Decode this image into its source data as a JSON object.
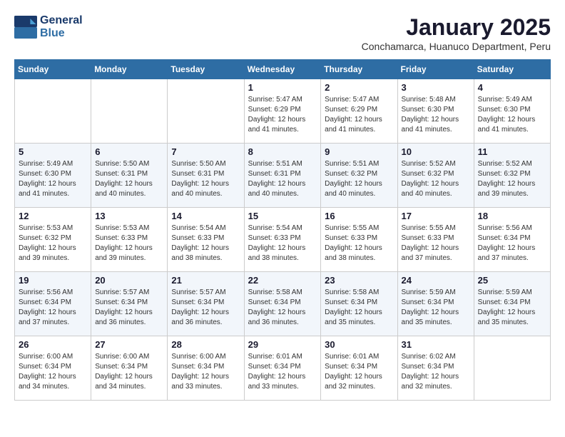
{
  "header": {
    "logo_line1": "General",
    "logo_line2": "Blue",
    "title": "January 2025",
    "subtitle": "Conchamarca, Huanuco Department, Peru"
  },
  "days_of_week": [
    "Sunday",
    "Monday",
    "Tuesday",
    "Wednesday",
    "Thursday",
    "Friday",
    "Saturday"
  ],
  "weeks": [
    [
      {
        "day": "",
        "info": ""
      },
      {
        "day": "",
        "info": ""
      },
      {
        "day": "",
        "info": ""
      },
      {
        "day": "1",
        "info": "Sunrise: 5:47 AM\nSunset: 6:29 PM\nDaylight: 12 hours\nand 41 minutes."
      },
      {
        "day": "2",
        "info": "Sunrise: 5:47 AM\nSunset: 6:29 PM\nDaylight: 12 hours\nand 41 minutes."
      },
      {
        "day": "3",
        "info": "Sunrise: 5:48 AM\nSunset: 6:30 PM\nDaylight: 12 hours\nand 41 minutes."
      },
      {
        "day": "4",
        "info": "Sunrise: 5:49 AM\nSunset: 6:30 PM\nDaylight: 12 hours\nand 41 minutes."
      }
    ],
    [
      {
        "day": "5",
        "info": "Sunrise: 5:49 AM\nSunset: 6:30 PM\nDaylight: 12 hours\nand 41 minutes."
      },
      {
        "day": "6",
        "info": "Sunrise: 5:50 AM\nSunset: 6:31 PM\nDaylight: 12 hours\nand 40 minutes."
      },
      {
        "day": "7",
        "info": "Sunrise: 5:50 AM\nSunset: 6:31 PM\nDaylight: 12 hours\nand 40 minutes."
      },
      {
        "day": "8",
        "info": "Sunrise: 5:51 AM\nSunset: 6:31 PM\nDaylight: 12 hours\nand 40 minutes."
      },
      {
        "day": "9",
        "info": "Sunrise: 5:51 AM\nSunset: 6:32 PM\nDaylight: 12 hours\nand 40 minutes."
      },
      {
        "day": "10",
        "info": "Sunrise: 5:52 AM\nSunset: 6:32 PM\nDaylight: 12 hours\nand 40 minutes."
      },
      {
        "day": "11",
        "info": "Sunrise: 5:52 AM\nSunset: 6:32 PM\nDaylight: 12 hours\nand 39 minutes."
      }
    ],
    [
      {
        "day": "12",
        "info": "Sunrise: 5:53 AM\nSunset: 6:32 PM\nDaylight: 12 hours\nand 39 minutes."
      },
      {
        "day": "13",
        "info": "Sunrise: 5:53 AM\nSunset: 6:33 PM\nDaylight: 12 hours\nand 39 minutes."
      },
      {
        "day": "14",
        "info": "Sunrise: 5:54 AM\nSunset: 6:33 PM\nDaylight: 12 hours\nand 38 minutes."
      },
      {
        "day": "15",
        "info": "Sunrise: 5:54 AM\nSunset: 6:33 PM\nDaylight: 12 hours\nand 38 minutes."
      },
      {
        "day": "16",
        "info": "Sunrise: 5:55 AM\nSunset: 6:33 PM\nDaylight: 12 hours\nand 38 minutes."
      },
      {
        "day": "17",
        "info": "Sunrise: 5:55 AM\nSunset: 6:33 PM\nDaylight: 12 hours\nand 37 minutes."
      },
      {
        "day": "18",
        "info": "Sunrise: 5:56 AM\nSunset: 6:34 PM\nDaylight: 12 hours\nand 37 minutes."
      }
    ],
    [
      {
        "day": "19",
        "info": "Sunrise: 5:56 AM\nSunset: 6:34 PM\nDaylight: 12 hours\nand 37 minutes."
      },
      {
        "day": "20",
        "info": "Sunrise: 5:57 AM\nSunset: 6:34 PM\nDaylight: 12 hours\nand 36 minutes."
      },
      {
        "day": "21",
        "info": "Sunrise: 5:57 AM\nSunset: 6:34 PM\nDaylight: 12 hours\nand 36 minutes."
      },
      {
        "day": "22",
        "info": "Sunrise: 5:58 AM\nSunset: 6:34 PM\nDaylight: 12 hours\nand 36 minutes."
      },
      {
        "day": "23",
        "info": "Sunrise: 5:58 AM\nSunset: 6:34 PM\nDaylight: 12 hours\nand 35 minutes."
      },
      {
        "day": "24",
        "info": "Sunrise: 5:59 AM\nSunset: 6:34 PM\nDaylight: 12 hours\nand 35 minutes."
      },
      {
        "day": "25",
        "info": "Sunrise: 5:59 AM\nSunset: 6:34 PM\nDaylight: 12 hours\nand 35 minutes."
      }
    ],
    [
      {
        "day": "26",
        "info": "Sunrise: 6:00 AM\nSunset: 6:34 PM\nDaylight: 12 hours\nand 34 minutes."
      },
      {
        "day": "27",
        "info": "Sunrise: 6:00 AM\nSunset: 6:34 PM\nDaylight: 12 hours\nand 34 minutes."
      },
      {
        "day": "28",
        "info": "Sunrise: 6:00 AM\nSunset: 6:34 PM\nDaylight: 12 hours\nand 33 minutes."
      },
      {
        "day": "29",
        "info": "Sunrise: 6:01 AM\nSunset: 6:34 PM\nDaylight: 12 hours\nand 33 minutes."
      },
      {
        "day": "30",
        "info": "Sunrise: 6:01 AM\nSunset: 6:34 PM\nDaylight: 12 hours\nand 32 minutes."
      },
      {
        "day": "31",
        "info": "Sunrise: 6:02 AM\nSunset: 6:34 PM\nDaylight: 12 hours\nand 32 minutes."
      },
      {
        "day": "",
        "info": ""
      }
    ]
  ]
}
